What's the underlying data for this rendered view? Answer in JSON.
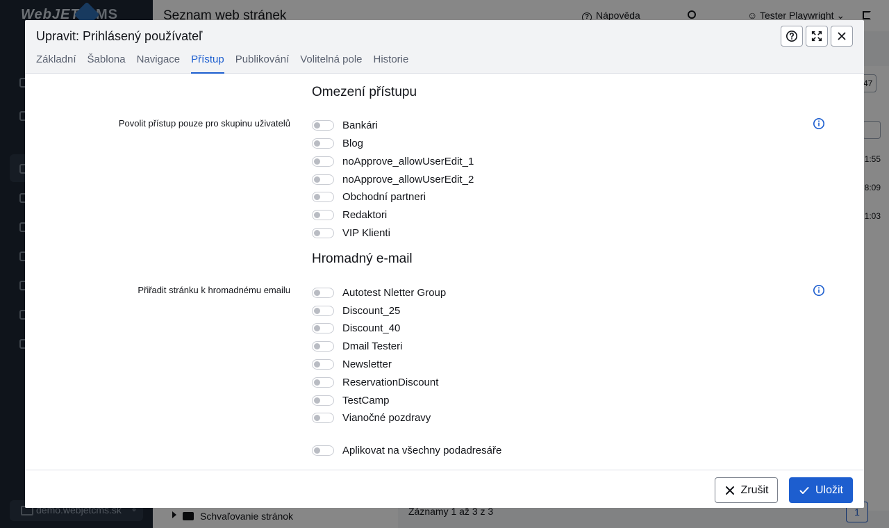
{
  "background": {
    "logo": {
      "web": "WebJET",
      "cms": "CMS"
    },
    "page_title": "Seznam web stránek",
    "help_label": "Nápověda",
    "user_name": "Tester Playwright",
    "domain": "demo.webjetcms.sk",
    "page_count": "47",
    "times": [
      "1:55",
      "8:09",
      "1:03"
    ],
    "tree_item": "Schvaľovanie stránok",
    "records": "Záznamy 1 až 3 z 3",
    "current_page": "1"
  },
  "modal": {
    "title": "Upravit: Prihlásený používateľ",
    "tabs": [
      {
        "label": "Základní"
      },
      {
        "label": "Šablona"
      },
      {
        "label": "Navigace"
      },
      {
        "label": "Přístup",
        "active": true
      },
      {
        "label": "Publikování"
      },
      {
        "label": "Volitelná pole"
      },
      {
        "label": "Historie"
      }
    ],
    "access": {
      "section_title": "Omezení přístupu",
      "field_label": "Povolit přístup pouze pro skupinu uživatelů",
      "options": [
        "Bankári",
        "Blog",
        "noApprove_allowUserEdit_1",
        "noApprove_allowUserEdit_2",
        "Obchodní partneri",
        "Redaktori",
        "VIP Klienti"
      ]
    },
    "mailing": {
      "section_title": "Hromadný e-mail",
      "field_label": "Přiřadit stránku k hromadnému emailu",
      "options": [
        "Autotest Nletter Group",
        "Discount_25",
        "Discount_40",
        "Dmail Testeri",
        "Newsletter",
        "ReservationDiscount",
        "TestCamp",
        "Vianočné pozdravy"
      ]
    },
    "apply_subfolders": "Aplikovat na všechny podadresáře",
    "cancel_label": "Zrušit",
    "save_label": "Uložit"
  },
  "colors": {
    "accent": "#1d5ecf",
    "sidebar": "#1e2733"
  }
}
